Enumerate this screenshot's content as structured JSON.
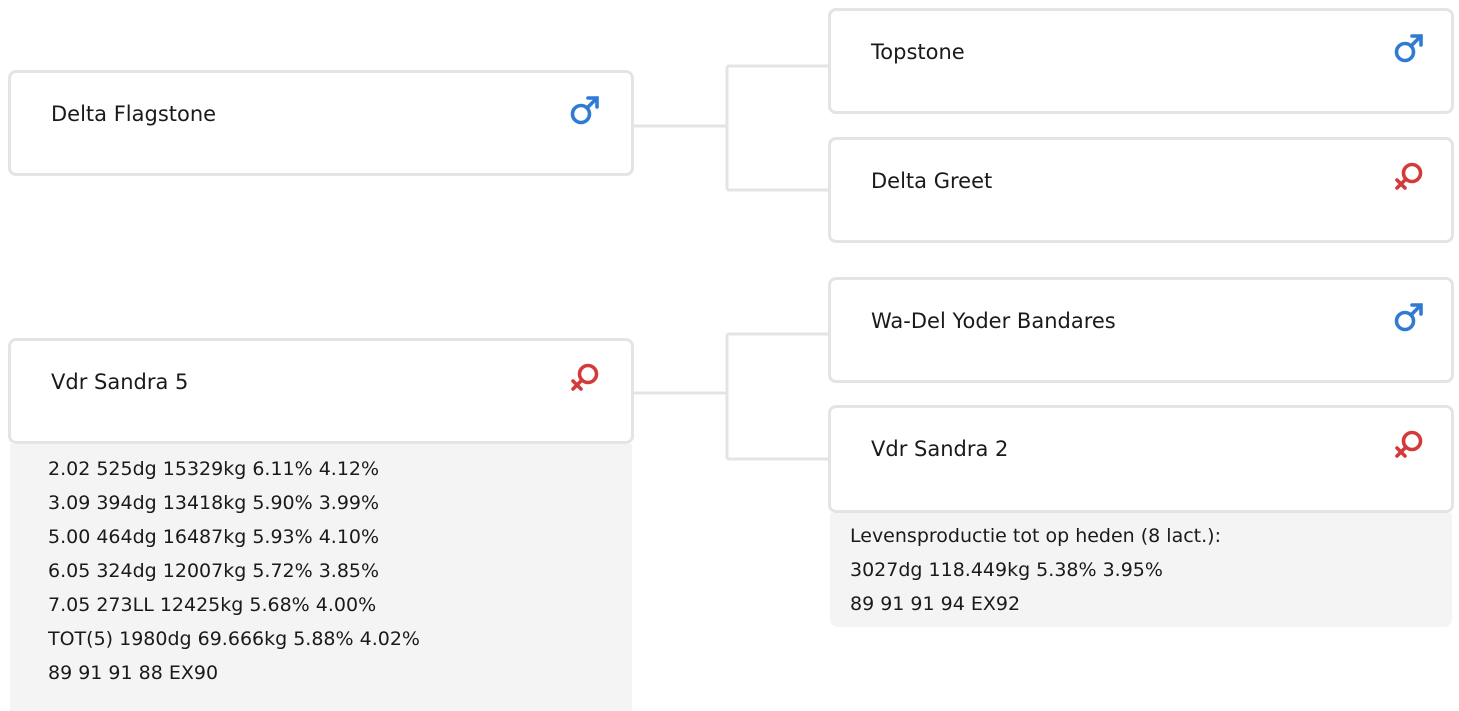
{
  "pedigree": {
    "sire": {
      "name": "Delta Flagstone",
      "sex": "male",
      "icon": "male-icon",
      "sire": {
        "name": "Topstone",
        "sex": "male",
        "icon": "male-icon"
      },
      "dam": {
        "name": "Delta Greet",
        "sex": "female",
        "icon": "female-icon"
      }
    },
    "dam": {
      "name": "Vdr Sandra 5",
      "sex": "female",
      "icon": "female-icon",
      "stats": [
        "2.02 525dg 15329kg 6.11% 4.12%",
        "3.09 394dg 13418kg 5.90% 3.99%",
        "5.00 464dg 16487kg 5.93% 4.10%",
        "6.05 324dg 12007kg 5.72% 3.85%",
        "7.05 273LL 12425kg 5.68% 4.00%",
        "TOT(5) 1980dg 69.666kg 5.88% 4.02%",
        "89 91 91 88 EX90"
      ],
      "sire": {
        "name": "Wa-Del Yoder Bandares",
        "sex": "male",
        "icon": "male-icon"
      },
      "dam": {
        "name": "Vdr Sandra 2",
        "sex": "female",
        "icon": "female-icon",
        "stats": [
          "Levensproductie tot op heden (8 lact.):",
          "3027dg 118.449kg 5.38% 3.95%",
          "89 91 91 94 EX92"
        ]
      }
    }
  },
  "colors": {
    "male": "#2f7bd3",
    "female": "#d33a3a",
    "connector": "#e4e4e4",
    "stats_bg": "#f4f4f4"
  }
}
